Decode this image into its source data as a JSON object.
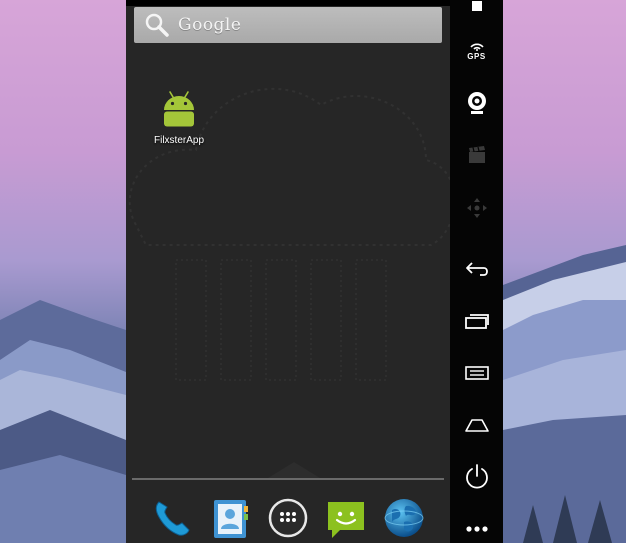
{
  "home": {
    "search": {
      "brand_text": "Google",
      "icon": "search-icon"
    },
    "apps": [
      {
        "label": "FilxsterApp",
        "icon": "android-app-icon"
      }
    ],
    "dock": [
      {
        "icon": "phone-icon"
      },
      {
        "icon": "contacts-icon"
      },
      {
        "icon": "all-apps-icon"
      },
      {
        "icon": "messaging-icon"
      },
      {
        "icon": "browser-icon"
      }
    ]
  },
  "controls": {
    "gps_label": "GPS",
    "buttons": [
      "power-indicator-icon",
      "gps-icon",
      "camera-icon",
      "clapperboard-icon",
      "dpad-icon",
      "back-icon",
      "recent-apps-icon",
      "menu-icon",
      "home-icon",
      "power-icon",
      "more-icon"
    ]
  },
  "colors": {
    "screen_bg": "#262626",
    "android_green": "#a4c639",
    "control_strip": "#050505",
    "search_bar": "#b5b5b5"
  }
}
